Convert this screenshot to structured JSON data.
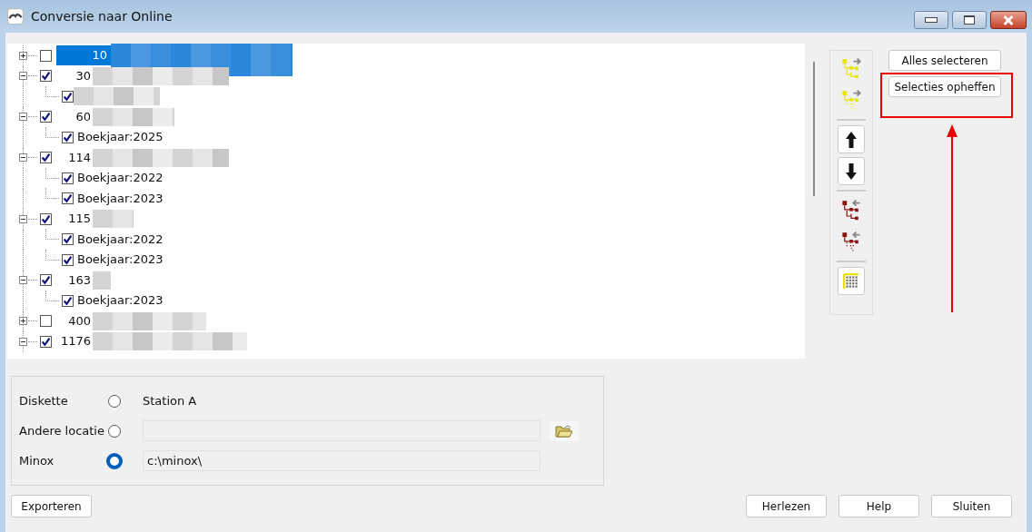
{
  "window": {
    "title": "Conversie naar Online"
  },
  "tree": [
    {
      "label": "10",
      "checked": false,
      "expanded": false,
      "selected": true,
      "redacted": true
    },
    {
      "label": "30",
      "checked": true,
      "expanded": true,
      "selected": false,
      "redacted": true,
      "children": [
        {
          "checked": true,
          "selected": false,
          "redacted": true
        }
      ]
    },
    {
      "label": "60",
      "checked": true,
      "expanded": true,
      "selected": false,
      "redacted": true,
      "children": [
        {
          "label": "Boekjaar:2025",
          "checked": true,
          "selected": false
        }
      ]
    },
    {
      "label": "114",
      "checked": true,
      "expanded": true,
      "selected": false,
      "redacted": true,
      "children": [
        {
          "label": "Boekjaar:2022",
          "checked": true,
          "selected": false
        },
        {
          "label": "Boekjaar:2023",
          "checked": true,
          "selected": false
        }
      ]
    },
    {
      "label": "115",
      "checked": true,
      "expanded": true,
      "selected": false,
      "redacted": true,
      "children": [
        {
          "label": "Boekjaar:2022",
          "checked": true,
          "selected": false
        },
        {
          "label": "Boekjaar:2023",
          "checked": true,
          "selected": false
        }
      ]
    },
    {
      "label": "163",
      "checked": true,
      "expanded": true,
      "selected": false,
      "redacted": true,
      "children": [
        {
          "label": "Boekjaar:2023",
          "checked": true,
          "selected": false
        }
      ]
    },
    {
      "label": "400",
      "checked": false,
      "expanded": false,
      "selected": false,
      "redacted": true
    },
    {
      "label": "1176",
      "checked": true,
      "expanded": true,
      "selected": false,
      "redacted": true
    }
  ],
  "side_buttons": [
    "Alles selecteren",
    "Selecties opheffen"
  ],
  "destinations": [
    {
      "kind": "text",
      "label": "Diskette",
      "selected": false,
      "text": "Station A"
    },
    {
      "kind": "browse",
      "label": "Andere locatie",
      "selected": false
    },
    {
      "kind": "field",
      "label": "Minox",
      "selected": true,
      "value": "c:\\minox\\"
    }
  ],
  "left_buttons": [
    "Exporteren"
  ],
  "right_buttons": [
    "Herlezen",
    "Help",
    "Sluiten"
  ]
}
